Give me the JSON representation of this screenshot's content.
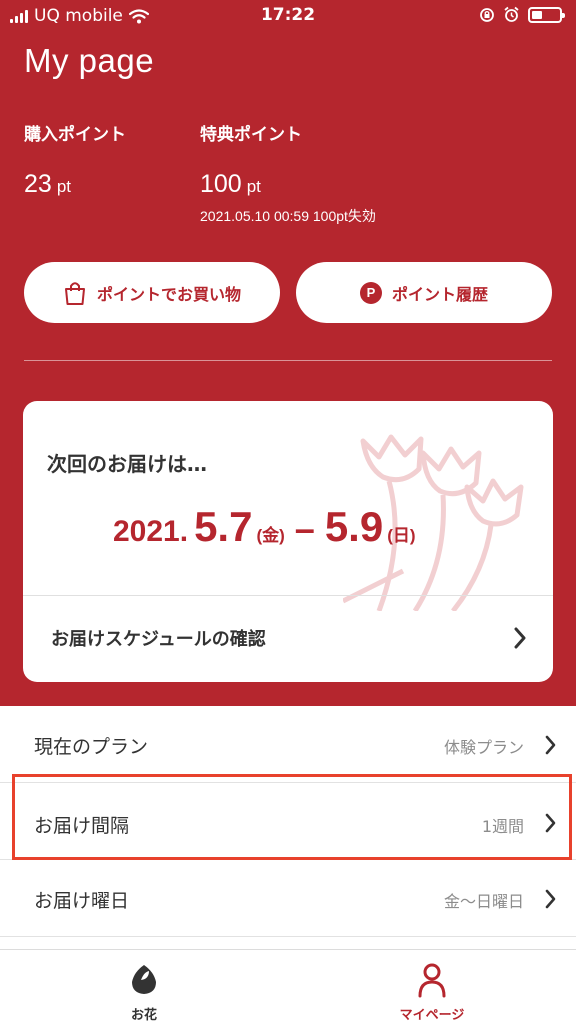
{
  "status_bar": {
    "carrier": "UQ mobile",
    "time": "17:22"
  },
  "header": {
    "title": "My page"
  },
  "points": {
    "purchase": {
      "label": "購入ポイント",
      "value": "23",
      "unit": "pt"
    },
    "bonus": {
      "label": "特典ポイント",
      "value": "100",
      "unit": "pt",
      "expiry": "2021.05.10 00:59 100pt失効"
    }
  },
  "buttons": {
    "shop_label": "ポイントでお買い物",
    "history_label": "ポイント履歴",
    "history_icon_letter": "P"
  },
  "delivery_card": {
    "heading": "次回のお届けは…",
    "year": "2021.",
    "start_date": "5.7",
    "start_day": "(金)",
    "dash": "–",
    "end_date": "5.9",
    "end_day": "(日)",
    "schedule_link": "お届けスケジュールの確認"
  },
  "settings": {
    "plan": {
      "label": "現在のプラン",
      "value": "体験プラン"
    },
    "interval": {
      "label": "お届け間隔",
      "value": "1週間"
    },
    "weekday": {
      "label": "お届け曜日",
      "value": "金〜日曜日"
    }
  },
  "tabbar": {
    "flowers_label": "お花",
    "mypage_label": "マイページ"
  },
  "colors": {
    "brand_red": "#b5262e",
    "highlight": "#e8412c",
    "muted_text": "#8c8c8c"
  }
}
